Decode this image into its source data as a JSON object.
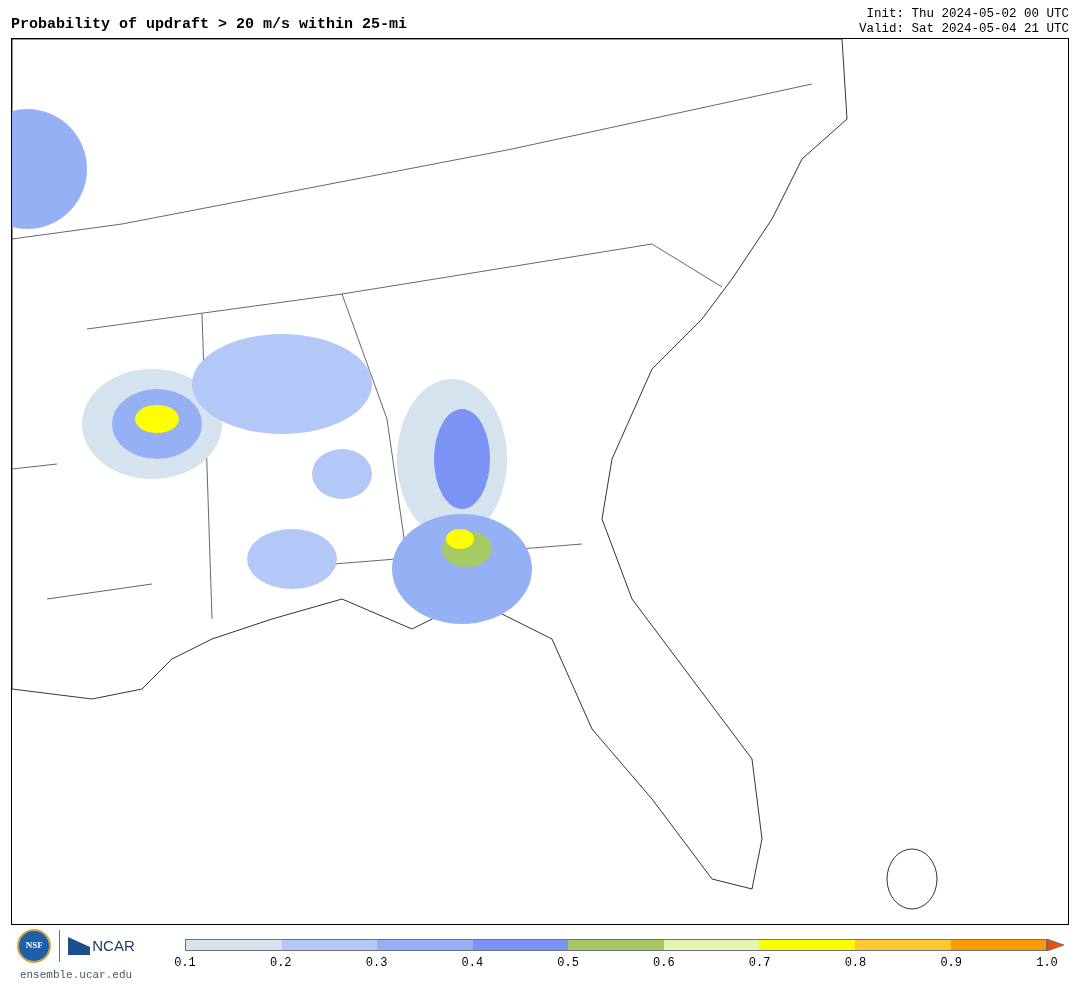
{
  "title": "Probability of updraft > 20 m/s within 25-mi",
  "init": "Init: Thu 2024-05-02 00 UTC",
  "valid": "Valid: Sat 2024-05-04 21 UTC",
  "logo": {
    "nsf": "NSF",
    "ncar": "NCAR",
    "url": "ensemble.ucar.edu"
  },
  "colorbar": {
    "bins": [
      {
        "color": "#d6e2ed"
      },
      {
        "color": "#b4c8f8"
      },
      {
        "color": "#96b0f5"
      },
      {
        "color": "#7b93f5"
      },
      {
        "color": "#a6c964"
      },
      {
        "color": "#e6f5b0"
      },
      {
        "color": "#ffff00"
      },
      {
        "color": "#ffc830"
      },
      {
        "color": "#ff9a00"
      }
    ],
    "extend": {
      "color": "#e65010"
    },
    "ticks": [
      "0.1",
      "0.2",
      "0.3",
      "0.4",
      "0.5",
      "0.6",
      "0.7",
      "0.8",
      "0.9",
      "1.0"
    ]
  }
}
